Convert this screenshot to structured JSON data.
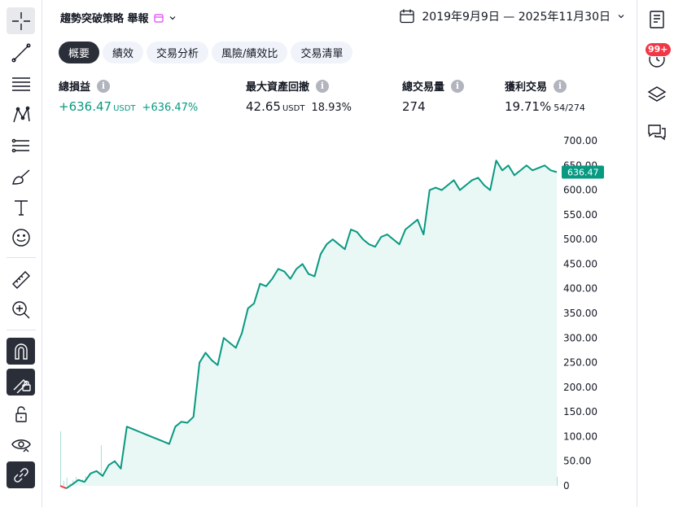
{
  "header": {
    "title": "趨勢突破策略 舉報",
    "date_range": "2019年9月9日 — 2025年11月30日"
  },
  "tabs": [
    {
      "label": "概要",
      "active": true
    },
    {
      "label": "績效",
      "active": false
    },
    {
      "label": "交易分析",
      "active": false
    },
    {
      "label": "風險/績效比",
      "active": false
    },
    {
      "label": "交易清單",
      "active": false
    }
  ],
  "metrics": [
    {
      "label": "總損益",
      "value": "+636.47",
      "unit": "USDT",
      "sub": "+636.47%",
      "positive": true
    },
    {
      "label": "最大資產回撤",
      "value": "42.65",
      "unit": "USDT",
      "sub": "18.93%",
      "positive": false
    },
    {
      "label": "總交易量",
      "value": "274",
      "unit": "",
      "sub": "",
      "positive": false
    },
    {
      "label": "獲利交易",
      "value": "19.71%",
      "unit": "",
      "sub": "54/274",
      "positive": false
    }
  ],
  "right_bar": {
    "notification_badge": "99+"
  },
  "colors": {
    "equity_line": "#089981",
    "equity_fill": "#e9f7f5",
    "drawdown": "#f23645",
    "volume": "#a7ddd6"
  },
  "chart_data": {
    "type": "area",
    "ylim": [
      0,
      700
    ],
    "yticks": [
      "0",
      "50.00",
      "100.00",
      "150.00",
      "200.00",
      "250.00",
      "300.00",
      "350.00",
      "400.00",
      "450.00",
      "500.00",
      "550.00",
      "600.00",
      "650.00",
      "700.00"
    ],
    "last_value_label": "636.47",
    "series": [
      {
        "values": [
          0,
          -5,
          3,
          12,
          8,
          25,
          30,
          20,
          42,
          50,
          35,
          120,
          115,
          110,
          105,
          100,
          95,
          90,
          85,
          120,
          130,
          128,
          140,
          250,
          270,
          255,
          245,
          300,
          290,
          280,
          310,
          360,
          370,
          410,
          405,
          420,
          440,
          435,
          420,
          440,
          450,
          430,
          425,
          470,
          490,
          500,
          490,
          480,
          520,
          515,
          500,
          490,
          485,
          505,
          510,
          500,
          490,
          520,
          530,
          540,
          510,
          600,
          605,
          600,
          610,
          620,
          600,
          610,
          620,
          625,
          610,
          600,
          660,
          640,
          650,
          630,
          640,
          650,
          640,
          645,
          650,
          640,
          636.47
        ]
      }
    ]
  }
}
